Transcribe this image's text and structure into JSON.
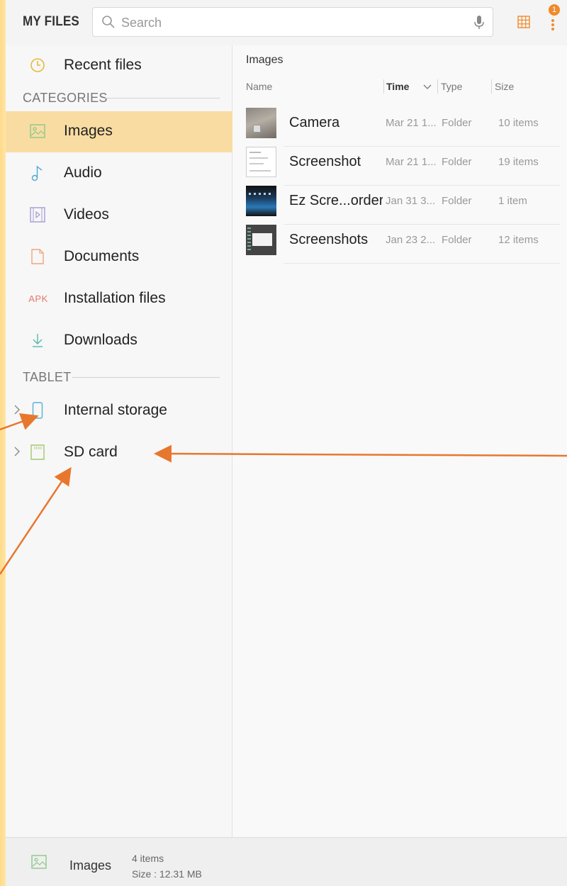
{
  "header": {
    "title": "MY FILES",
    "search_placeholder": "Search",
    "notification_count": "1"
  },
  "sidebar": {
    "recent_label": "Recent files",
    "categories_header": "CATEGORIES",
    "categories": [
      {
        "label": "Images",
        "icon": "image-icon",
        "active": true
      },
      {
        "label": "Audio",
        "icon": "music-note-icon"
      },
      {
        "label": "Videos",
        "icon": "video-icon"
      },
      {
        "label": "Documents",
        "icon": "document-icon"
      },
      {
        "label": "Installation files",
        "icon": "apk-icon",
        "icon_text": "APK"
      },
      {
        "label": "Downloads",
        "icon": "download-icon"
      }
    ],
    "tablet_header": "TABLET",
    "storage": [
      {
        "label": "Internal storage",
        "icon": "phone-icon"
      },
      {
        "label": "SD card",
        "icon": "sd-card-icon"
      }
    ]
  },
  "main": {
    "breadcrumb": "Images",
    "columns": {
      "name": "Name",
      "time": "Time",
      "type": "Type",
      "size": "Size"
    },
    "files": [
      {
        "name": "Camera",
        "time": "Mar 21 1...",
        "type": "Folder",
        "size": "10 items"
      },
      {
        "name": "Screenshot",
        "time": "Mar 21 1...",
        "type": "Folder",
        "size": "19 items"
      },
      {
        "name": "Ez Scre...order",
        "time": "Jan 31 3...",
        "type": "Folder",
        "size": "1 item"
      },
      {
        "name": "Screenshots",
        "time": "Jan 23 2...",
        "type": "Folder",
        "size": "12 items"
      }
    ]
  },
  "footer": {
    "label": "Images",
    "count": "4 items",
    "size": "Size : 12.31 MB"
  },
  "colors": {
    "accent": "#f08a2a",
    "active_bg": "#f9dca2",
    "annotation_arrow": "#e8772e"
  }
}
